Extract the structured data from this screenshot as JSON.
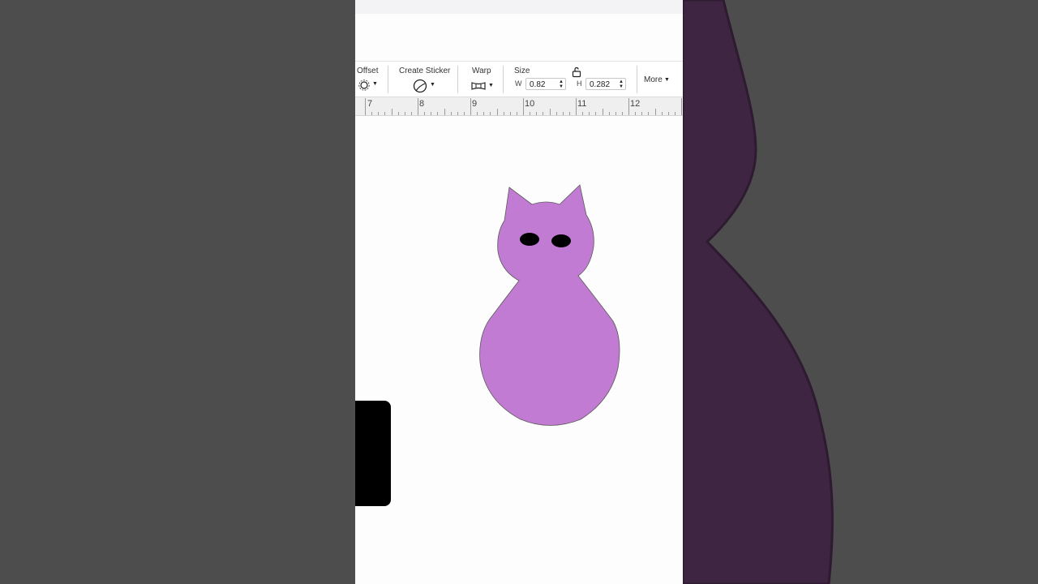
{
  "toolbar": {
    "offset_label": "Offset",
    "create_sticker_label": "Create Sticker",
    "warp_label": "Warp",
    "size_label": "Size",
    "width_letter": "W",
    "width_value": "0.82",
    "height_letter": "H",
    "height_value": "0.282",
    "more_label": "More"
  },
  "ruler": {
    "numbers": [
      "7",
      "8",
      "9",
      "10",
      "11",
      "12"
    ]
  },
  "canvas": {
    "shape_color": "#c17bd2",
    "eye_color": "#000000"
  },
  "colors": {
    "background": "#4d4d4d",
    "right_shape": "#3e2541"
  }
}
